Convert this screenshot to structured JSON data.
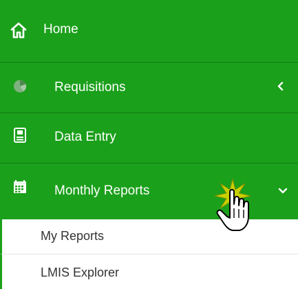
{
  "colors": {
    "menu_bg": "#1ba01b",
    "menu_text": "#ffffff",
    "submenu_bg": "#ffffff",
    "submenu_text": "#333333",
    "burst": "#c8d000"
  },
  "menu": {
    "items": [
      {
        "label": "Home",
        "icon": "home-icon"
      },
      {
        "label": "Requisitions",
        "icon": "pie-chart-icon",
        "chevron": "chevron-left-icon"
      },
      {
        "label": "Data Entry",
        "icon": "data-entry-icon"
      },
      {
        "label": "Monthly Reports",
        "icon": "calendar-icon",
        "chevron": "chevron-down-icon",
        "expanded": true
      }
    ],
    "subitems": [
      {
        "label": "My Reports"
      },
      {
        "label": "LMIS Explorer"
      }
    ]
  },
  "cursor": {
    "icon": "hand-pointer-icon",
    "effect": "click-burst"
  }
}
